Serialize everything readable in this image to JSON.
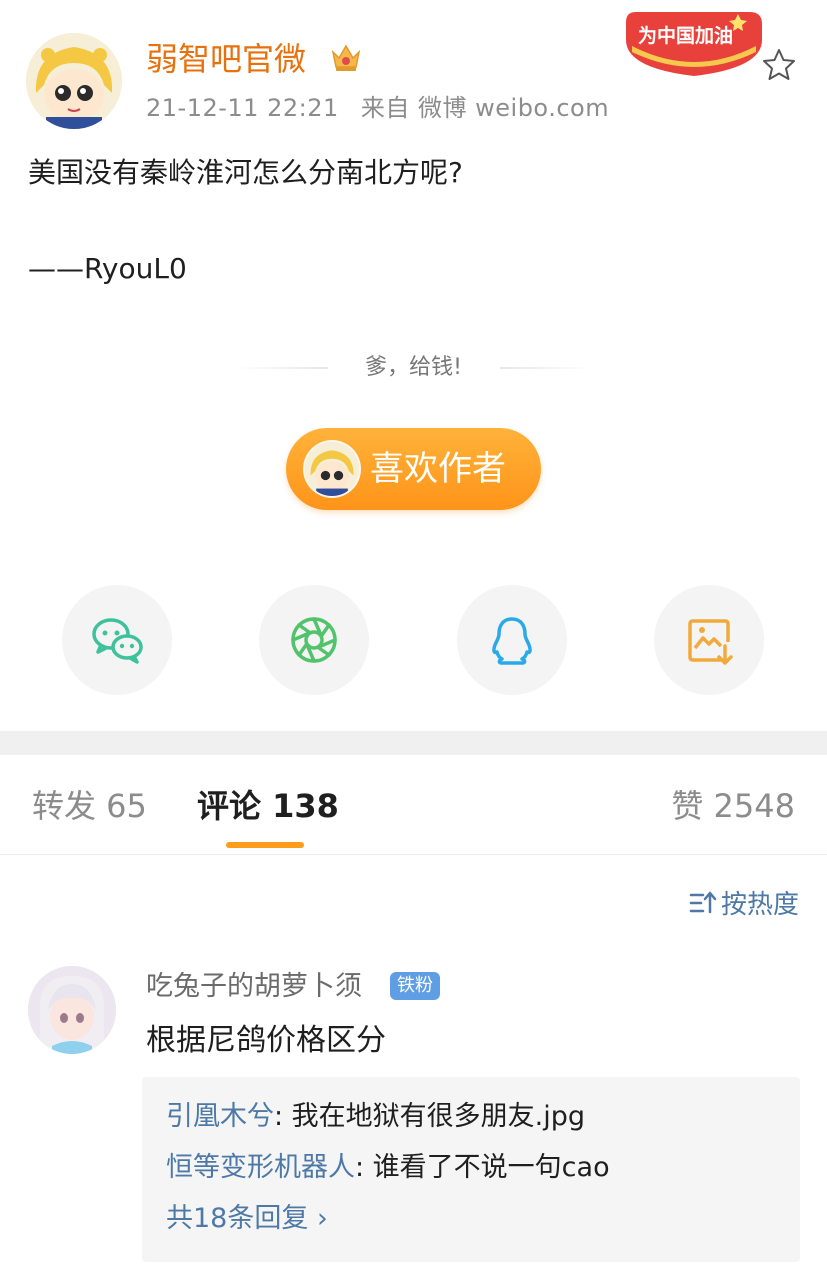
{
  "post": {
    "author": "弱智吧官微",
    "timestamp": "21-12-11 22:21",
    "source": "来自 微博 weibo.com",
    "badge_text": "为中国加油",
    "content": [
      "美国没有秦岭淮河怎么分南北方呢?",
      "——RyouL0"
    ]
  },
  "tip": {
    "text": "爹，给钱!",
    "button_label": "喜欢作者"
  },
  "share": [
    {
      "name": "wechat",
      "icon": "wechat-icon",
      "color": "#3ec29b"
    },
    {
      "name": "moments",
      "icon": "moments-icon",
      "color": "#53c36b"
    },
    {
      "name": "qq",
      "icon": "qq-icon",
      "color": "#2aa9e8"
    },
    {
      "name": "save-image",
      "icon": "save-image-icon",
      "color": "#f2a93b"
    }
  ],
  "tabs": {
    "repost": "转发 65",
    "comment": "评论 138",
    "like": "赞 2548"
  },
  "sort_label": "按热度",
  "comment": {
    "user": "吃兔子的胡萝卜须",
    "fan_badge": "铁粉",
    "text": "根据尼鸽价格区分",
    "replies": [
      {
        "user": "引凰木兮",
        "text": ": 我在地狱有很多朋友.jpg"
      },
      {
        "user": "恒等变形机器人",
        "text": ": 谁看了不说一句cao"
      }
    ],
    "more": "共18条回复 ›"
  },
  "colors": {
    "accent": "#e8710e",
    "link": "#4e79a7",
    "button": "#ff9c1a"
  }
}
